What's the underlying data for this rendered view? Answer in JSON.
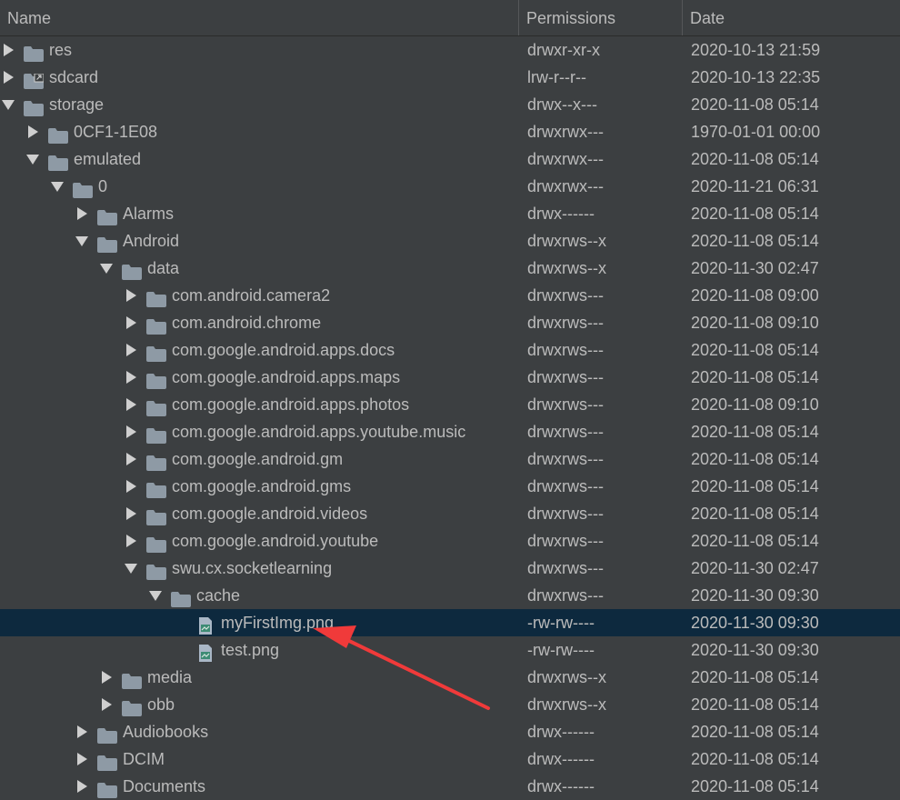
{
  "columns": {
    "name": "Name",
    "permissions": "Permissions",
    "date": "Date"
  },
  "colors": {
    "background": "#3c3f41",
    "selection": "#0d293e",
    "text": "#bbbbbb",
    "folder": "#8e9aa5",
    "arrow": "#f03a3a"
  },
  "rows": [
    {
      "depth": 0,
      "type": "folder",
      "state": "collapsed",
      "name": "res",
      "perm": "drwxr-xr-x",
      "date": "2020-10-13 21:59"
    },
    {
      "depth": 0,
      "type": "link",
      "state": "collapsed",
      "name": "sdcard",
      "perm": "lrw-r--r--",
      "date": "2020-10-13 22:35"
    },
    {
      "depth": 0,
      "type": "folder",
      "state": "expanded",
      "name": "storage",
      "perm": "drwx--x---",
      "date": "2020-11-08 05:14"
    },
    {
      "depth": 1,
      "type": "folder",
      "state": "collapsed",
      "name": "0CF1-1E08",
      "perm": "drwxrwx---",
      "date": "1970-01-01 00:00"
    },
    {
      "depth": 1,
      "type": "folder",
      "state": "expanded",
      "name": "emulated",
      "perm": "drwxrwx---",
      "date": "2020-11-08 05:14"
    },
    {
      "depth": 2,
      "type": "folder",
      "state": "expanded",
      "name": "0",
      "perm": "drwxrwx---",
      "date": "2020-11-21 06:31"
    },
    {
      "depth": 3,
      "type": "folder",
      "state": "collapsed",
      "name": "Alarms",
      "perm": "drwx------",
      "date": "2020-11-08 05:14"
    },
    {
      "depth": 3,
      "type": "folder",
      "state": "expanded",
      "name": "Android",
      "perm": "drwxrws--x",
      "date": "2020-11-08 05:14"
    },
    {
      "depth": 4,
      "type": "folder",
      "state": "expanded",
      "name": "data",
      "perm": "drwxrws--x",
      "date": "2020-11-30 02:47"
    },
    {
      "depth": 5,
      "type": "folder",
      "state": "collapsed",
      "name": "com.android.camera2",
      "perm": "drwxrws---",
      "date": "2020-11-08 09:00"
    },
    {
      "depth": 5,
      "type": "folder",
      "state": "collapsed",
      "name": "com.android.chrome",
      "perm": "drwxrws---",
      "date": "2020-11-08 09:10"
    },
    {
      "depth": 5,
      "type": "folder",
      "state": "collapsed",
      "name": "com.google.android.apps.docs",
      "perm": "drwxrws---",
      "date": "2020-11-08 05:14"
    },
    {
      "depth": 5,
      "type": "folder",
      "state": "collapsed",
      "name": "com.google.android.apps.maps",
      "perm": "drwxrws---",
      "date": "2020-11-08 05:14"
    },
    {
      "depth": 5,
      "type": "folder",
      "state": "collapsed",
      "name": "com.google.android.apps.photos",
      "perm": "drwxrws---",
      "date": "2020-11-08 09:10"
    },
    {
      "depth": 5,
      "type": "folder",
      "state": "collapsed",
      "name": "com.google.android.apps.youtube.music",
      "perm": "drwxrws---",
      "date": "2020-11-08 05:14"
    },
    {
      "depth": 5,
      "type": "folder",
      "state": "collapsed",
      "name": "com.google.android.gm",
      "perm": "drwxrws---",
      "date": "2020-11-08 05:14"
    },
    {
      "depth": 5,
      "type": "folder",
      "state": "collapsed",
      "name": "com.google.android.gms",
      "perm": "drwxrws---",
      "date": "2020-11-08 05:14"
    },
    {
      "depth": 5,
      "type": "folder",
      "state": "collapsed",
      "name": "com.google.android.videos",
      "perm": "drwxrws---",
      "date": "2020-11-08 05:14"
    },
    {
      "depth": 5,
      "type": "folder",
      "state": "collapsed",
      "name": "com.google.android.youtube",
      "perm": "drwxrws---",
      "date": "2020-11-08 05:14"
    },
    {
      "depth": 5,
      "type": "folder",
      "state": "expanded",
      "name": "swu.cx.socketlearning",
      "perm": "drwxrws---",
      "date": "2020-11-30 02:47"
    },
    {
      "depth": 6,
      "type": "folder",
      "state": "expanded",
      "name": "cache",
      "perm": "drwxrws---",
      "date": "2020-11-30 09:30"
    },
    {
      "depth": 7,
      "type": "image",
      "state": "leaf",
      "name": "myFirstImg.png",
      "perm": "-rw-rw----",
      "date": "2020-11-30 09:30",
      "selected": true
    },
    {
      "depth": 7,
      "type": "image",
      "state": "leaf",
      "name": "test.png",
      "perm": "-rw-rw----",
      "date": "2020-11-30 09:30"
    },
    {
      "depth": 4,
      "type": "folder",
      "state": "collapsed",
      "name": "media",
      "perm": "drwxrws--x",
      "date": "2020-11-08 05:14"
    },
    {
      "depth": 4,
      "type": "folder",
      "state": "collapsed",
      "name": "obb",
      "perm": "drwxrws--x",
      "date": "2020-11-08 05:14"
    },
    {
      "depth": 3,
      "type": "folder",
      "state": "collapsed",
      "name": "Audiobooks",
      "perm": "drwx------",
      "date": "2020-11-08 05:14"
    },
    {
      "depth": 3,
      "type": "folder",
      "state": "collapsed",
      "name": "DCIM",
      "perm": "drwx------",
      "date": "2020-11-08 05:14"
    },
    {
      "depth": 3,
      "type": "folder",
      "state": "collapsed",
      "name": "Documents",
      "perm": "drwx------",
      "date": "2020-11-08 05:14"
    }
  ]
}
